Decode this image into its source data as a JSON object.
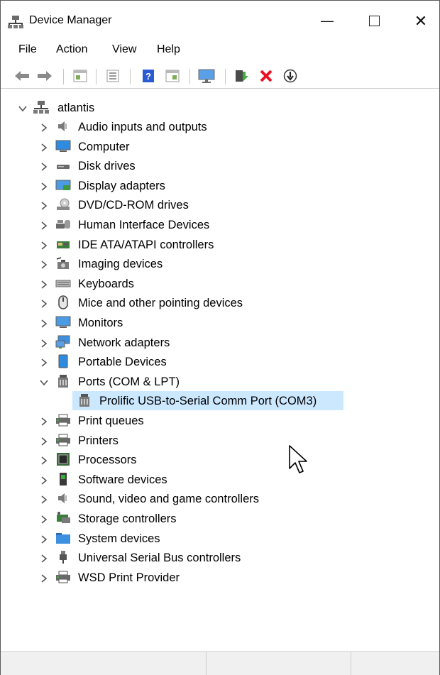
{
  "window": {
    "title": "Device Manager",
    "controls": {
      "minimize": "—",
      "close": "✕"
    }
  },
  "menu": {
    "file": "File",
    "action": "Action",
    "view": "View",
    "help": "Help"
  },
  "toolbar": {
    "icons": [
      "back-arrow-icon",
      "forward-arrow-icon",
      "properties-grid-icon",
      "scan-icon",
      "help-icon",
      "details-icon",
      "monitor-icon",
      "update-driver-icon",
      "uninstall-icon",
      "download-icon"
    ],
    "colors": {
      "uninstall": "#e81123",
      "help": "#2b5bd1"
    }
  },
  "tree": {
    "root": "atlantis",
    "categories": [
      {
        "label": "Audio inputs and outputs",
        "icon": "speaker-icon"
      },
      {
        "label": "Computer",
        "icon": "computer-icon"
      },
      {
        "label": "Disk drives",
        "icon": "disk-drive-icon"
      },
      {
        "label": "Display adapters",
        "icon": "display-adapter-icon"
      },
      {
        "label": "DVD/CD-ROM drives",
        "icon": "dvd-drive-icon"
      },
      {
        "label": "Human Interface Devices",
        "icon": "hid-icon"
      },
      {
        "label": "IDE ATA/ATAPI controllers",
        "icon": "ide-controller-icon"
      },
      {
        "label": "Imaging devices",
        "icon": "camera-icon"
      },
      {
        "label": "Keyboards",
        "icon": "keyboard-icon"
      },
      {
        "label": "Mice and other pointing devices",
        "icon": "mouse-icon"
      },
      {
        "label": "Monitors",
        "icon": "monitor-icon"
      },
      {
        "label": "Network adapters",
        "icon": "network-adapter-icon"
      },
      {
        "label": "Portable Devices",
        "icon": "portable-device-icon"
      },
      {
        "label": "Ports (COM & LPT)",
        "icon": "port-icon",
        "expanded": true
      },
      {
        "label": "Prolific USB-to-Serial Comm Port (COM3)",
        "icon": "port-icon",
        "child": true,
        "selected": true
      },
      {
        "label": "Print queues",
        "icon": "printer-icon"
      },
      {
        "label": "Printers",
        "icon": "printer-icon"
      },
      {
        "label": "Processors",
        "icon": "processor-icon"
      },
      {
        "label": "Software devices",
        "icon": "software-device-icon"
      },
      {
        "label": "Sound, video and game controllers",
        "icon": "speaker-icon"
      },
      {
        "label": "Storage controllers",
        "icon": "storage-controller-icon"
      },
      {
        "label": "System devices",
        "icon": "system-folder-icon"
      },
      {
        "label": "Universal Serial Bus controllers",
        "icon": "usb-icon"
      },
      {
        "label": "WSD Print Provider",
        "icon": "printer-icon"
      }
    ],
    "selection_color": "#cce8ff"
  }
}
